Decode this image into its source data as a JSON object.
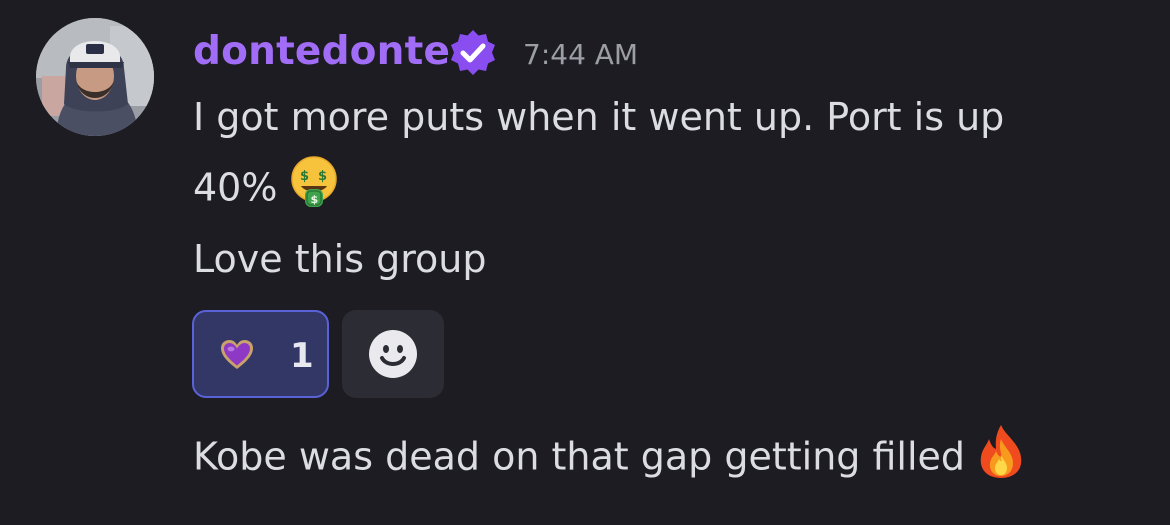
{
  "message": {
    "username": "dontedonte",
    "timestamp": "7:44 AM",
    "lines": [
      "I got more puts when it went up. Port is up",
      "40%",
      "Love this group",
      "Kobe was dead on that gap getting filled"
    ],
    "icons": {
      "verified": "verified-badge-icon",
      "money_mouth": "money-mouth-face-emoji",
      "fire": "fire-emoji",
      "purple_heart": "purple-heart-emoji",
      "add_reaction": "smiley-add-reaction-icon"
    },
    "reaction": {
      "emoji": "purple-heart",
      "count": "1"
    },
    "colors": {
      "background": "#1c1c22",
      "username": "#a26df6",
      "text": "#dcdde2",
      "timestamp": "#9c9ea6",
      "reaction_bg": "#333766",
      "reaction_border": "#5a62d8"
    }
  }
}
